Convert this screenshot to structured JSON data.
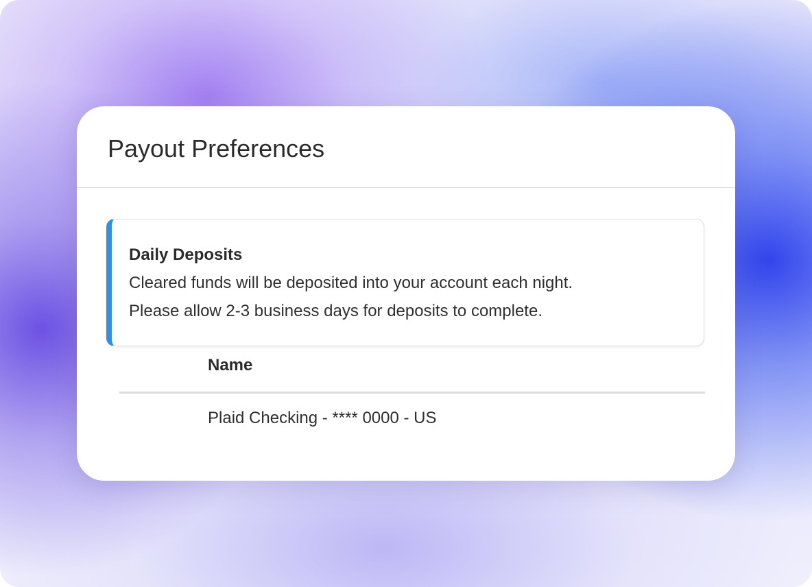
{
  "header": {
    "title": "Payout Preferences"
  },
  "notice": {
    "title": "Daily Deposits",
    "lines": [
      "Cleared funds will be deposited into your account each night.",
      "Please allow 2-3 business days for deposits to complete."
    ],
    "accent_color": "#2f8fe6"
  },
  "accounts_table": {
    "columns": [
      "Name"
    ],
    "rows": [
      [
        "Plaid Checking - **** 0000 - US"
      ]
    ]
  }
}
